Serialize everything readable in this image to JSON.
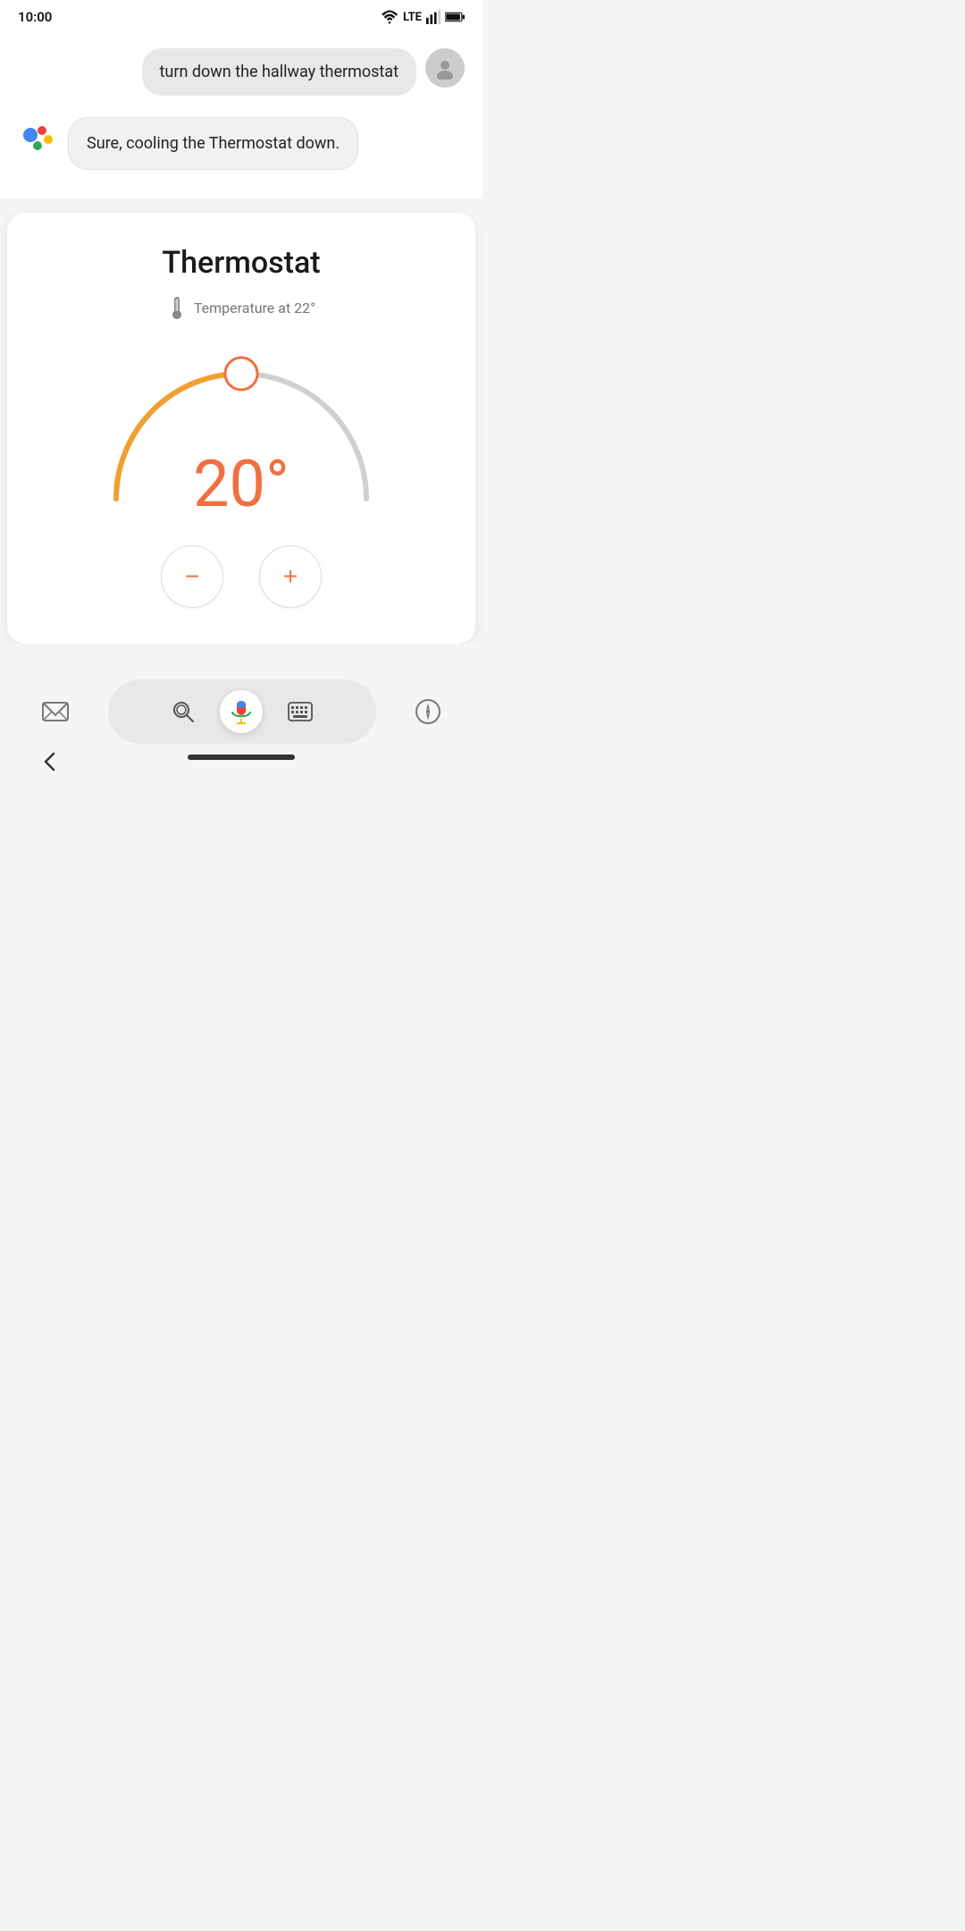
{
  "statusBar": {
    "time": "10:00",
    "lte": "LTE"
  },
  "chat": {
    "userMessage": "turn down the hallway thermostat",
    "assistantMessage": "Sure, cooling the Thermostat down."
  },
  "thermostat": {
    "title": "Thermostat",
    "tempLabel": "Temperature at 22°",
    "currentTemp": "20°",
    "decreaseLabel": "−",
    "increaseLabel": "+"
  },
  "googleDots": {
    "colors": [
      "#4285F4",
      "#EA4335",
      "#FBBC05",
      "#34A853"
    ]
  },
  "bottomNav": {
    "backLabel": "<"
  }
}
